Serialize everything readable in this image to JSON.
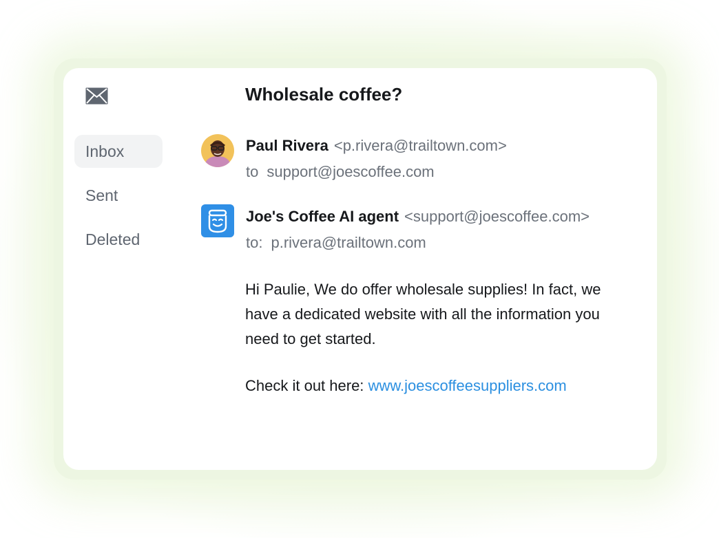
{
  "nav": {
    "items": [
      {
        "label": "Inbox",
        "active": true
      },
      {
        "label": "Sent",
        "active": false
      },
      {
        "label": "Deleted",
        "active": false
      }
    ]
  },
  "email": {
    "subject": "Wholesale coffee?",
    "messages": [
      {
        "sender_name": "Paul Rivera",
        "sender_email": "<p.rivera@trailtown.com>",
        "to_label": "to",
        "to_address": "support@joescoffee.com",
        "avatar": "person-photo"
      },
      {
        "sender_name": "Joe's Coffee AI agent",
        "sender_email": "<support@joescoffee.com>",
        "to_label": "to:",
        "to_address": "p.rivera@trailtown.com",
        "avatar": "ai-agent-icon"
      }
    ],
    "body": "Hi Paulie, We do offer wholesale supplies! In fact, we have a dedicated website with all the information you need to get started.",
    "cta_prefix": "Check it out here:",
    "cta_link": "www.joescoffeesuppliers.com"
  },
  "colors": {
    "link": "#2b8fe0",
    "agent_icon_bg": "#2f8fe6",
    "frame_glow": "#edf6e2"
  }
}
